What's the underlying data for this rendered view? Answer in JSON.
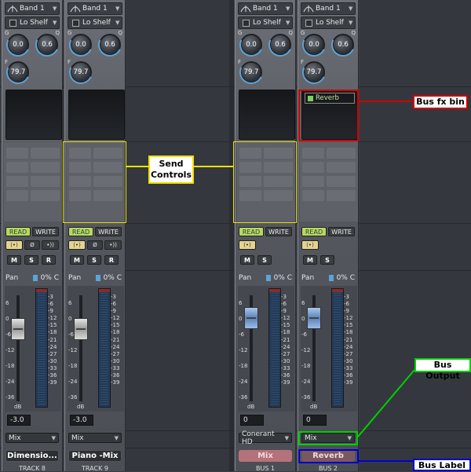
{
  "strips": [
    {
      "id": "track8",
      "band": "Band 1",
      "eq_type": "Lo Shelf",
      "knob_gain": "0.0",
      "knob_q": "0.6",
      "knob_freq": "79.7",
      "read": "READ",
      "write": "WRITE",
      "pan_label": "Pan",
      "pan_value": "0% C",
      "fader_value": "-3.0",
      "output": "Mix",
      "name": "Dimensio...",
      "track": "TRACK 8"
    },
    {
      "id": "track9",
      "band": "Band 1",
      "eq_type": "Lo Shelf",
      "knob_gain": "0.0",
      "knob_q": "0.6",
      "knob_freq": "79.7",
      "read": "READ",
      "write": "WRITE",
      "pan_label": "Pan",
      "pan_value": "0% C",
      "fader_value": "-3.0",
      "output": "Mix",
      "name": "Piano -Mix",
      "track": "TRACK 9"
    },
    {
      "id": "bus1",
      "band": "Band 1",
      "eq_type": "Lo Shelf",
      "knob_gain": "0.0",
      "knob_q": "0.6",
      "knob_freq": "79.7",
      "read": "READ",
      "write": "WRITE",
      "pan_label": "Pan",
      "pan_value": "0% C",
      "fader_value": "0",
      "output": "Conerant HD",
      "name": "Mix",
      "track": "BUS 1"
    },
    {
      "id": "bus2",
      "band": "Band 1",
      "eq_type": "Lo Shelf",
      "knob_gain": "0.0",
      "knob_q": "0.6",
      "knob_freq": "79.7",
      "read": "READ",
      "write": "WRITE",
      "pan_label": "Pan",
      "pan_value": "0% C",
      "fader_value": "0",
      "output": "Mix",
      "name": "Reverb",
      "track": "BUS 2",
      "fx": "Reverb"
    }
  ],
  "labels": {
    "g": "G",
    "q": "Q",
    "f": "F",
    "m": "M",
    "s": "S",
    "r": "R",
    "db": "dB"
  },
  "meter_scale": [
    "-3",
    "-6",
    "-9",
    "-12",
    "-15",
    "-18",
    "-21",
    "-24",
    "-27",
    "-30",
    "-33",
    "-36",
    "-39"
  ],
  "fader_scale": [
    "6",
    "0",
    "-6",
    "-12",
    "-18",
    "-24",
    "-36"
  ],
  "callouts": {
    "send_controls": "Send Controls",
    "bus_fx_bin": "Bus fx bin",
    "bus_output": "Bus Output",
    "bus_label": "Bus Label"
  },
  "colors": {
    "send": "#f0e000",
    "fxbin": "#d00000",
    "output": "#00d000",
    "label": "#0000d0",
    "read": "#b9d860",
    "mix_label": "#b5727a"
  }
}
